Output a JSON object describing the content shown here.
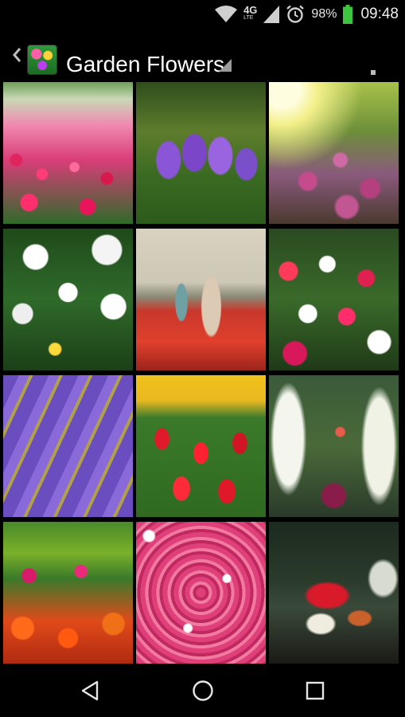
{
  "status_bar": {
    "network_type": "4G",
    "network_sub": "LTE",
    "battery_percent": "98%",
    "time": "09:48"
  },
  "action_bar": {
    "title": "Garden Flowers",
    "icons": [
      "back-chevron-icon",
      "app-icon",
      "dropdown-triangle-icon",
      "overflow-menu-icon"
    ]
  },
  "gallery": {
    "tiles": [
      {
        "name": "tile-pink-tulip-field"
      },
      {
        "name": "tile-purple-crocus"
      },
      {
        "name": "tile-pink-echinacea-sunlight"
      },
      {
        "name": "tile-white-daisies"
      },
      {
        "name": "tile-girl-in-red-tulips"
      },
      {
        "name": "tile-pink-white-daisy-field"
      },
      {
        "name": "tile-lavender-rows"
      },
      {
        "name": "tile-red-yellow-tulips"
      },
      {
        "name": "tile-white-snapdragons"
      },
      {
        "name": "tile-orange-pink-tulips-park"
      },
      {
        "name": "tile-pink-impatiens"
      },
      {
        "name": "tile-geranium-pots-patio"
      }
    ]
  },
  "nav_bar": {
    "icons": [
      "back-triangle-icon",
      "home-circle-icon",
      "recents-square-icon"
    ]
  },
  "colors": {
    "background": "#000000",
    "title_text": "#ffffff"
  }
}
